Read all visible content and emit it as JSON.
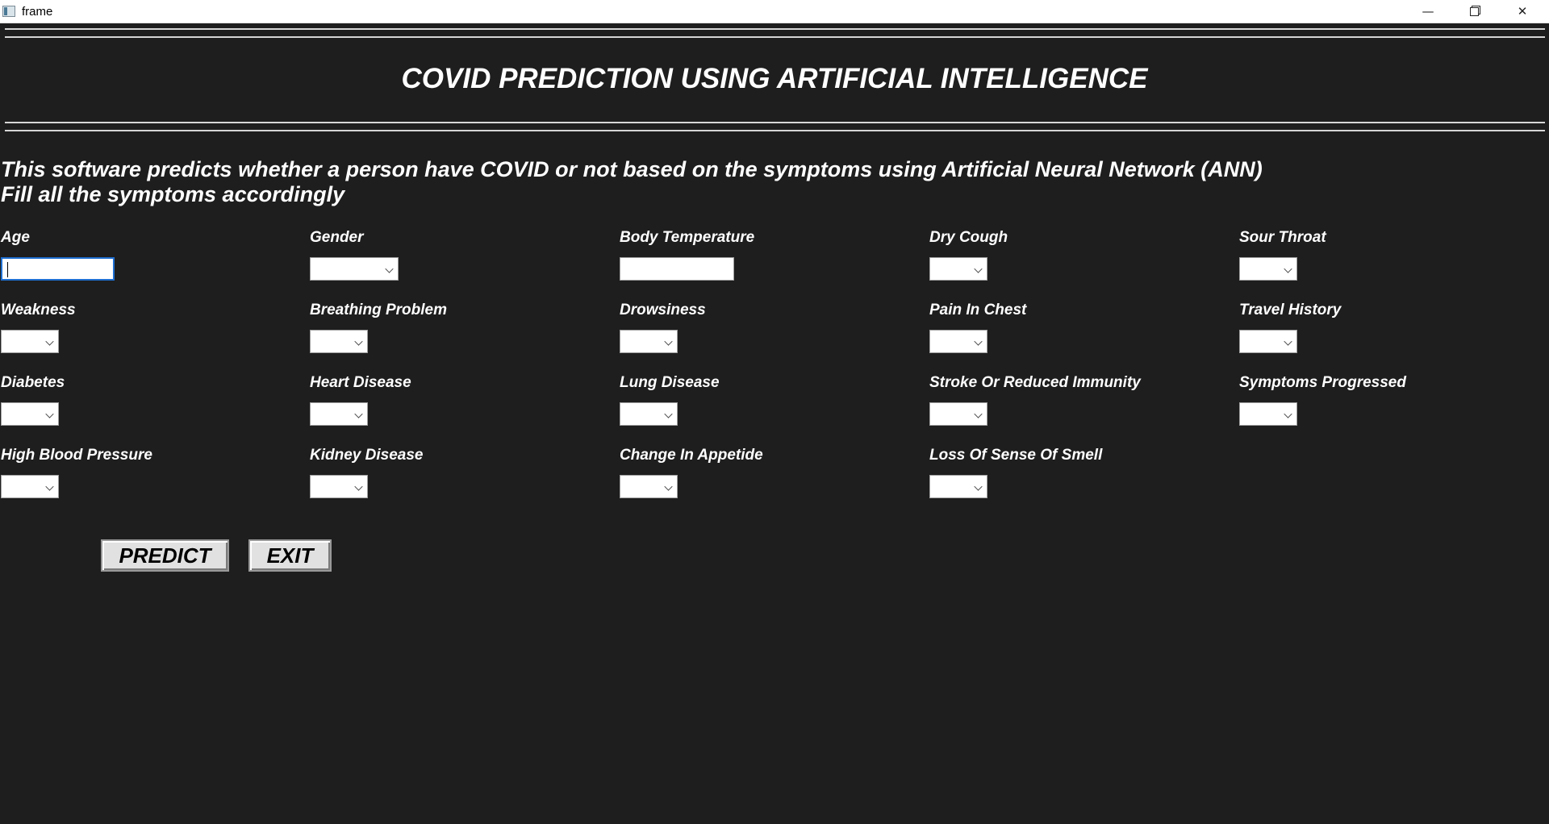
{
  "window": {
    "title": "frame",
    "minimize_glyph": "—",
    "close_glyph": "✕"
  },
  "heading": "COVID PREDICTION USING ARTIFICIAL INTELLIGENCE",
  "intro": {
    "line1": "This software predicts whether a person have COVID or not based on the symptoms using Artificial Neural Network (ANN)",
    "line2": "Fill all the symptoms accordingly"
  },
  "fields": {
    "age": "Age",
    "gender": "Gender",
    "body_temperature": "Body Temperature",
    "dry_cough": "Dry Cough",
    "sour_throat": "Sour Throat",
    "weakness": "Weakness",
    "breathing_problem": "Breathing Problem",
    "drowsiness": "Drowsiness",
    "pain_in_chest": "Pain In Chest",
    "travel_history": "Travel History",
    "diabetes": "Diabetes",
    "heart_disease": "Heart Disease",
    "lung_disease": "Lung Disease",
    "stroke_or_reduced_immunity": "Stroke Or Reduced Immunity",
    "symptoms_progressed": "Symptoms Progressed",
    "high_blood_pressure": "High Blood Pressure",
    "kidney_disease": "Kidney Disease",
    "change_in_appetide": "Change In Appetide",
    "loss_of_sense_of_smell": "Loss Of Sense Of Smell"
  },
  "buttons": {
    "predict": "PREDICT",
    "exit": "EXIT"
  },
  "icons": {
    "app": "window-app-icon",
    "minimize": "minimize-icon",
    "maximize": "restore-icon",
    "close": "close-icon",
    "dropdown": "chevron-down-icon"
  },
  "colors": {
    "background": "#1e1e1e",
    "text": "#ffffff",
    "focus_border": "#1f6fd1",
    "button_face": "#e1e1e1"
  }
}
